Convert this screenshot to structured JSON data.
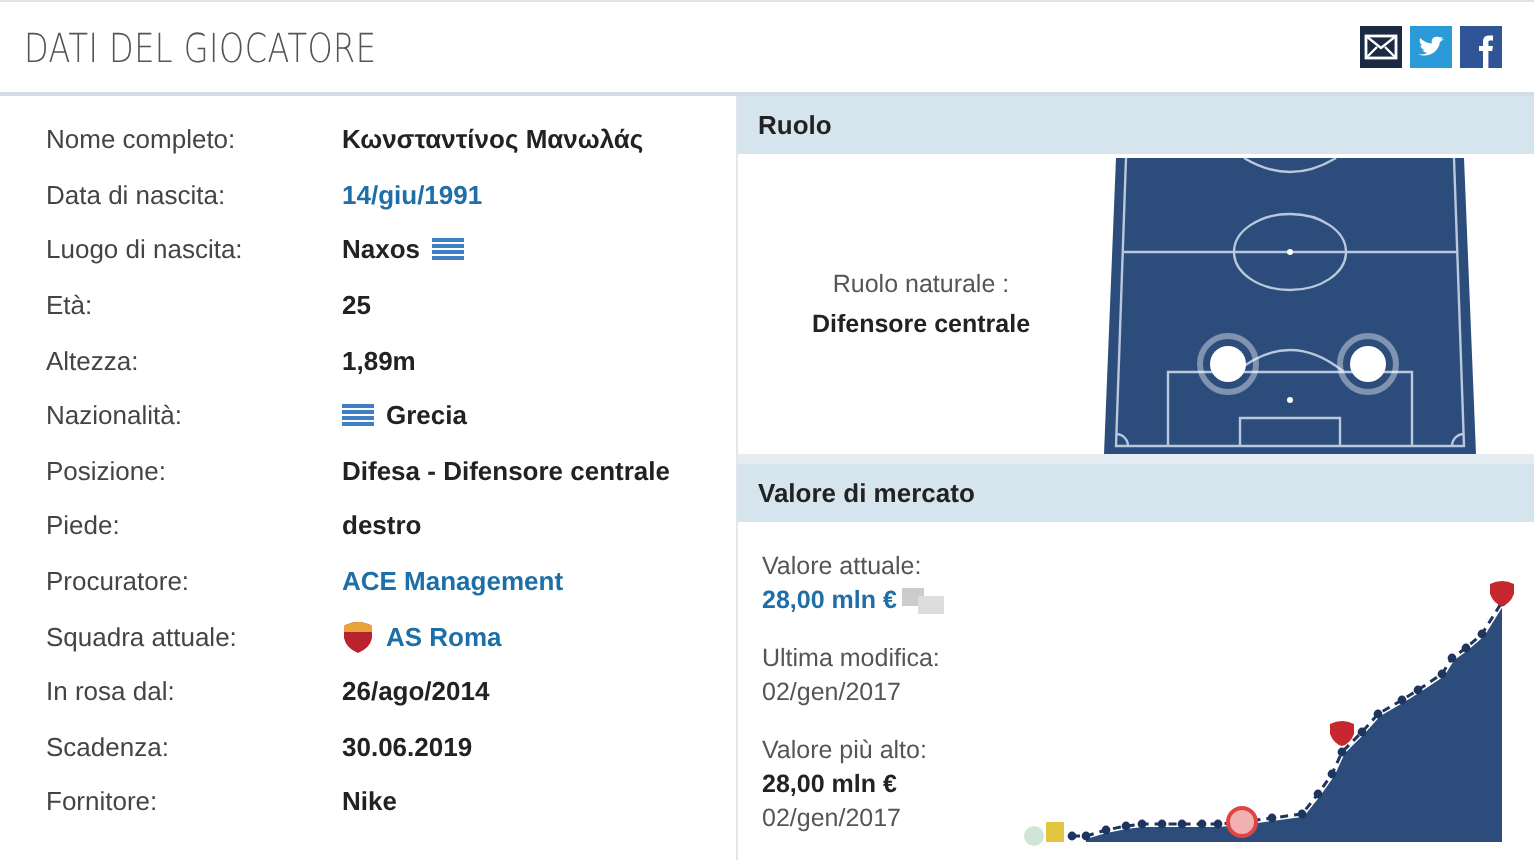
{
  "header": {
    "title": "DATI DEL GIOCATORE"
  },
  "details": [
    {
      "label": "Nome completo:",
      "value": "Κωνσταντίνος Μανωλάς",
      "kind": "text"
    },
    {
      "label": "Data di nascita:",
      "value": "14/giu/1991",
      "kind": "link"
    },
    {
      "label": "Luogo di nascita:",
      "value": "Naxos",
      "kind": "place"
    },
    {
      "label": "Età:",
      "value": "25",
      "kind": "text"
    },
    {
      "label": "Altezza:",
      "value": "1,89m",
      "kind": "text"
    },
    {
      "label": "Nazionalità:",
      "value": "Grecia",
      "kind": "nation"
    },
    {
      "label": "Posizione:",
      "value": "Difesa - Difensore centrale",
      "kind": "text"
    },
    {
      "label": "Piede:",
      "value": "destro",
      "kind": "text"
    },
    {
      "label": "Procuratore:",
      "value": "ACE Management",
      "kind": "link"
    },
    {
      "label": "Squadra attuale:",
      "value": "AS Roma",
      "kind": "club"
    },
    {
      "label": "In rosa dal:",
      "value": "26/ago/2014",
      "kind": "text"
    },
    {
      "label": "Scadenza:",
      "value": "30.06.2019",
      "kind": "text"
    },
    {
      "label": "Fornitore:",
      "value": "Nike",
      "kind": "text"
    }
  ],
  "role": {
    "heading": "Ruolo",
    "caption": "Ruolo naturale :",
    "value": "Difensore centrale"
  },
  "market": {
    "heading": "Valore di mercato",
    "current_label": "Valore attuale:",
    "current_value": "28,00 mln €",
    "last_change_label": "Ultima modifica:",
    "last_change_date": "02/gen/2017",
    "highest_label": "Valore più alto:",
    "highest_value": "28,00 mln €",
    "highest_date": "02/gen/2017"
  }
}
